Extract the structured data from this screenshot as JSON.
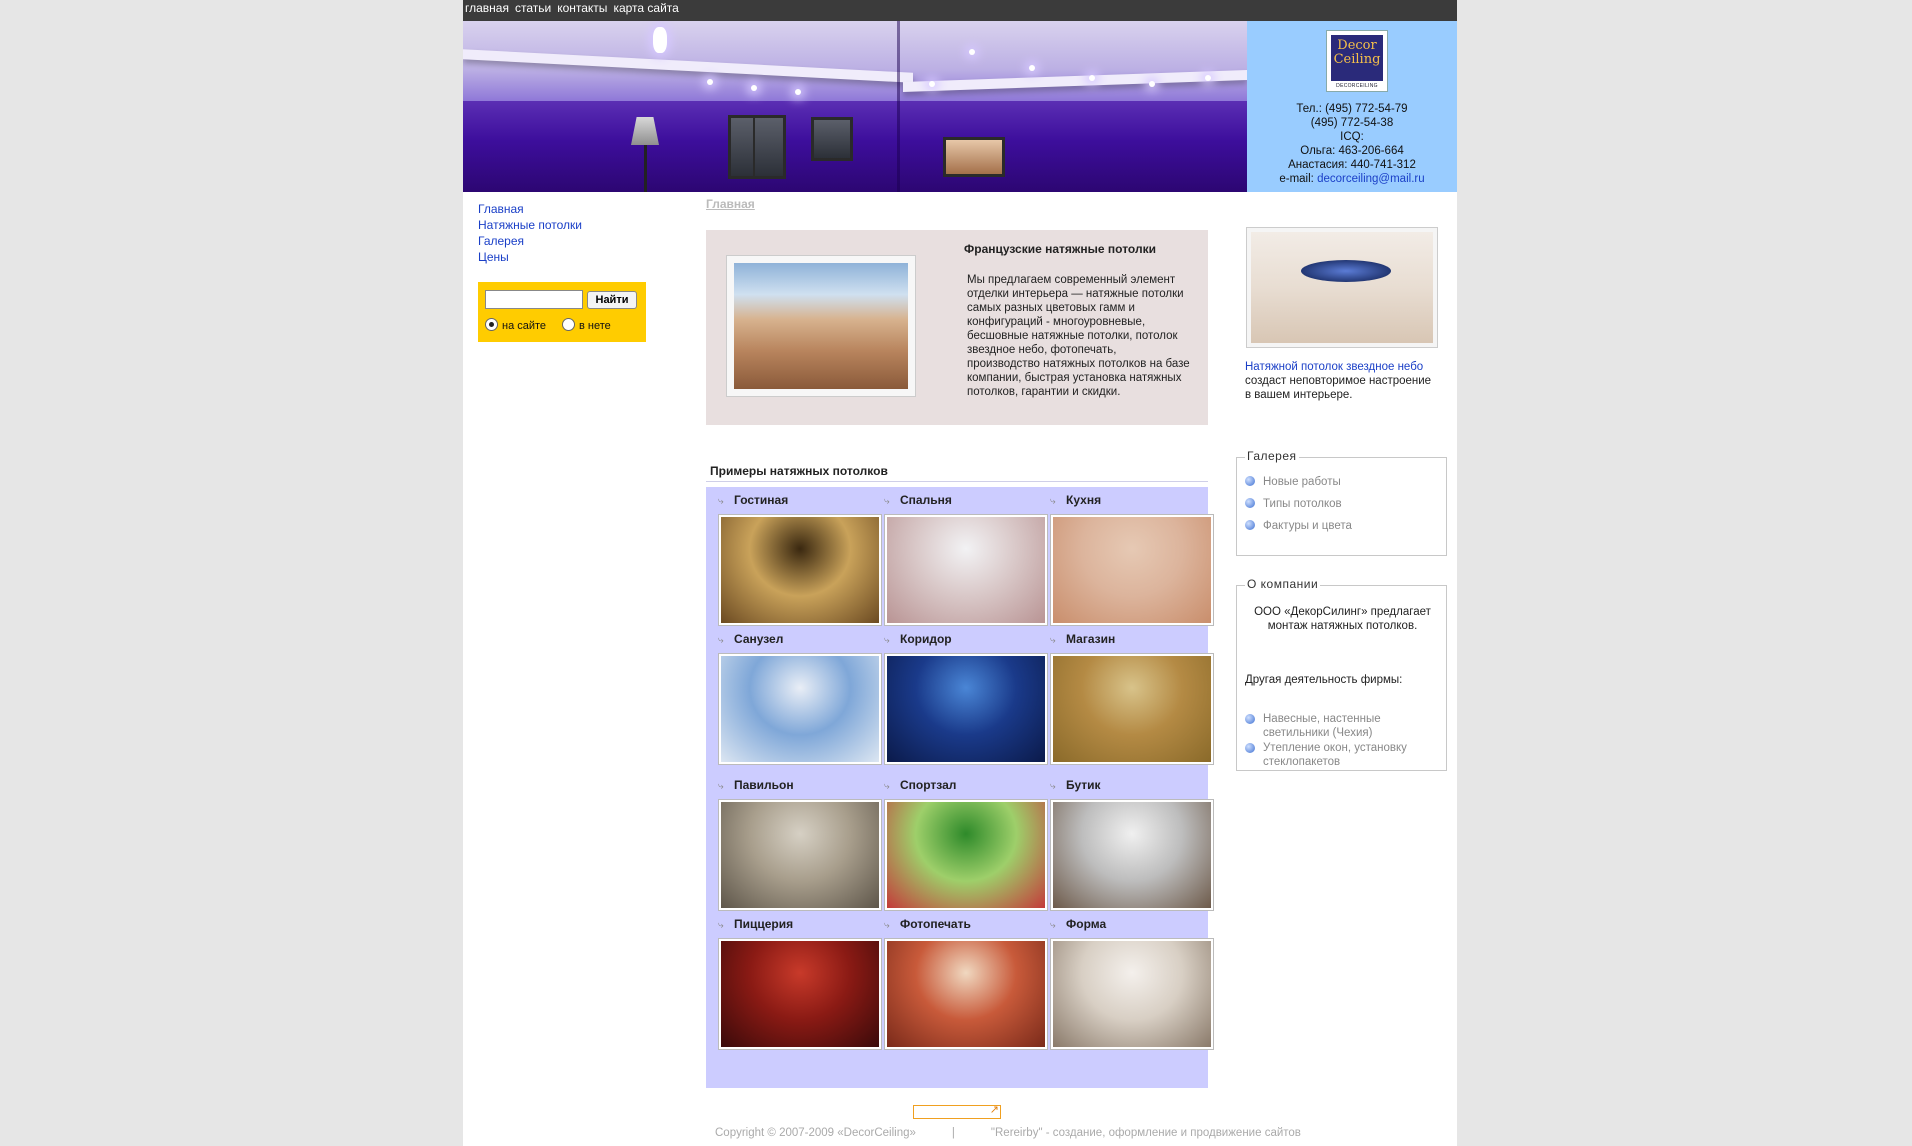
{
  "topnav": [
    "главная",
    "статьи",
    "контакты",
    "карта сайта"
  ],
  "contacts": {
    "logo_text": "Decor Ceiling",
    "logo_sub": "DECORCEILING",
    "tel1": "Тел.: (495) 772-54-79",
    "tel2": "(495) 772-54-38",
    "icq_label": "ICQ:",
    "icq1": "Ольга: 463-206-664",
    "icq2": "Анастасия: 440-741-312",
    "email_label": "e-mail: ",
    "email": "decorceiling@mail.ru"
  },
  "leftnav": [
    "Главная",
    "Натяжные потолки",
    "Галерея",
    "Цены"
  ],
  "search": {
    "button": "Найти",
    "opt_site": "на сайте",
    "opt_web": "в нете"
  },
  "breadcrumb": "Главная",
  "intro": {
    "title": "Французские натяжные потолки",
    "text": "Мы предлагаем современный элемент отделки интерьера — натяжные потолки самых разных цветовых гамм и конфигураций - многоуровневые, бесшовные натяжные потолки, потолок звездное небо, фотопечать, производство натяжных потолков на базе компании, быстрая установка натяжных потолков, гарантии и скидки."
  },
  "examples": {
    "title": "Примеры натяжных потолков",
    "items": [
      {
        "label": "Гостиная",
        "colors": [
          "#3a2810",
          "#c9a25a",
          "#6b4a22"
        ]
      },
      {
        "label": "Спальня",
        "colors": [
          "#f2f2f4",
          "#d9c8c8",
          "#b99494"
        ]
      },
      {
        "label": "Кухня",
        "colors": [
          "#e6c9b4",
          "#dcb49c",
          "#c98e6c"
        ]
      },
      {
        "label": "Санузел",
        "colors": [
          "#e9eef6",
          "#7fa7d8",
          "#dce6f2"
        ]
      },
      {
        "label": "Коридор",
        "colors": [
          "#4a86d6",
          "#1a3a8a",
          "#0b1a4a"
        ]
      },
      {
        "label": "Магазин",
        "colors": [
          "#d8c38a",
          "#b48a44",
          "#8a6a2a"
        ]
      },
      {
        "label": "Павильон",
        "colors": [
          "#d6d0c4",
          "#a89e8c",
          "#5e564a"
        ]
      },
      {
        "label": "Спортзал",
        "colors": [
          "#2e8a2a",
          "#9ecf6a",
          "#c43a3a"
        ]
      },
      {
        "label": "Бутик",
        "colors": [
          "#f0f0f0",
          "#bdbdbd",
          "#6d5a4a"
        ]
      },
      {
        "label": "Пиццерия",
        "colors": [
          "#c83a2a",
          "#8a1a14",
          "#3a0a0a"
        ]
      },
      {
        "label": "Фотопечать",
        "colors": [
          "#f0d8c0",
          "#c85a3a",
          "#7a2a1a"
        ]
      },
      {
        "label": "Форма",
        "colors": [
          "#f4f0ec",
          "#d8cfc4",
          "#8a7a6a"
        ]
      }
    ]
  },
  "right": {
    "caption_link": "Натяжной потолок звездное небо",
    "caption_text": "создаст неповторимое настроение в вашем интерьере.",
    "gallery_title": "Галерея",
    "gallery_items": [
      "Новые работы",
      "Типы потолков",
      "Фактуры и цвета"
    ],
    "about_title": "О компании",
    "about_text": "ООО «ДекорСилинг» предлагает монтаж натяжных потолков.",
    "other_title": "Другая деятельность фирмы:",
    "other_items": [
      "Навесные, настенные светильники (Чехия)",
      "Утепление окон, установку стеклопакетов"
    ]
  },
  "footer": {
    "copyright": "Copyright © 2007-2009 «DecorCeiling»",
    "sep": "|",
    "credit": "\"Rereirby\" - создание, оформление и продвижение сайтов"
  },
  "colors": {
    "topnav_bg": "#3b3b3b",
    "contacts_bg": "#99ccff",
    "search_bg": "#ffcc00",
    "intro_bg": "#e8dfdf",
    "grid_bg": "#ccccff",
    "link": "#1a3fc7"
  }
}
